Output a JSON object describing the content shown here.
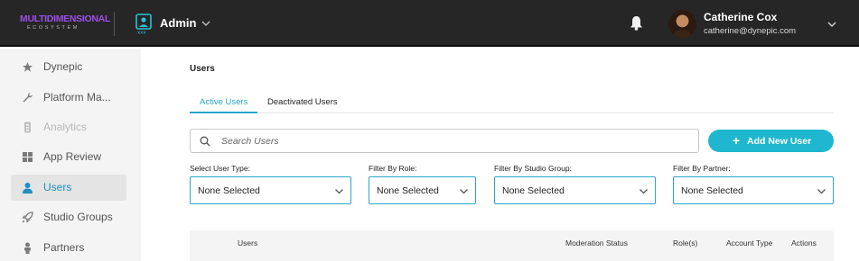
{
  "header": {
    "logo_main": "MULTIDIMENSIONAL",
    "logo_sub": "ECOSYSTEM",
    "workspace_label": "Admin",
    "user_name": "Catherine Cox",
    "user_email": "catherine@dynepic.com",
    "icons": [
      "admin-user-icon",
      "chevron-down-icon",
      "bell-icon",
      "avatar",
      "chevron-down-icon"
    ]
  },
  "sidebar": {
    "items": [
      {
        "label": "Dynepic",
        "icon": "star-icon"
      },
      {
        "label": "Platform Ma...",
        "icon": "wrench-icon"
      },
      {
        "label": "Analytics",
        "icon": "analytics-icon"
      },
      {
        "label": "App Review",
        "icon": "grid-icon"
      },
      {
        "label": "Users",
        "icon": "person-icon"
      },
      {
        "label": "Studio Groups",
        "icon": "rocket-icon"
      },
      {
        "label": "Partners",
        "icon": "partner-icon"
      }
    ]
  },
  "main": {
    "title": "Users",
    "tabs": [
      {
        "label": "Active Users"
      },
      {
        "label": "Deactivated Users"
      }
    ],
    "search_placeholder": "Search Users",
    "add_button_label": "Add New User",
    "filters": [
      {
        "label": "Select User Type:",
        "value": "None Selected"
      },
      {
        "label": "Filter By Role:",
        "value": "None Selected"
      },
      {
        "label": "Filter By Studio Group:",
        "value": "None Selected"
      },
      {
        "label": "Filter By Partner:",
        "value": "None Selected"
      }
    ],
    "table_columns": [
      "Users",
      "Moderation Status",
      "Role(s)",
      "Account Type",
      "Actions"
    ]
  },
  "colors": {
    "accent": "#1fb7cf",
    "active_nav": "#1f8fbf",
    "topbar": "#262626",
    "logo": "#9b4fe8"
  }
}
